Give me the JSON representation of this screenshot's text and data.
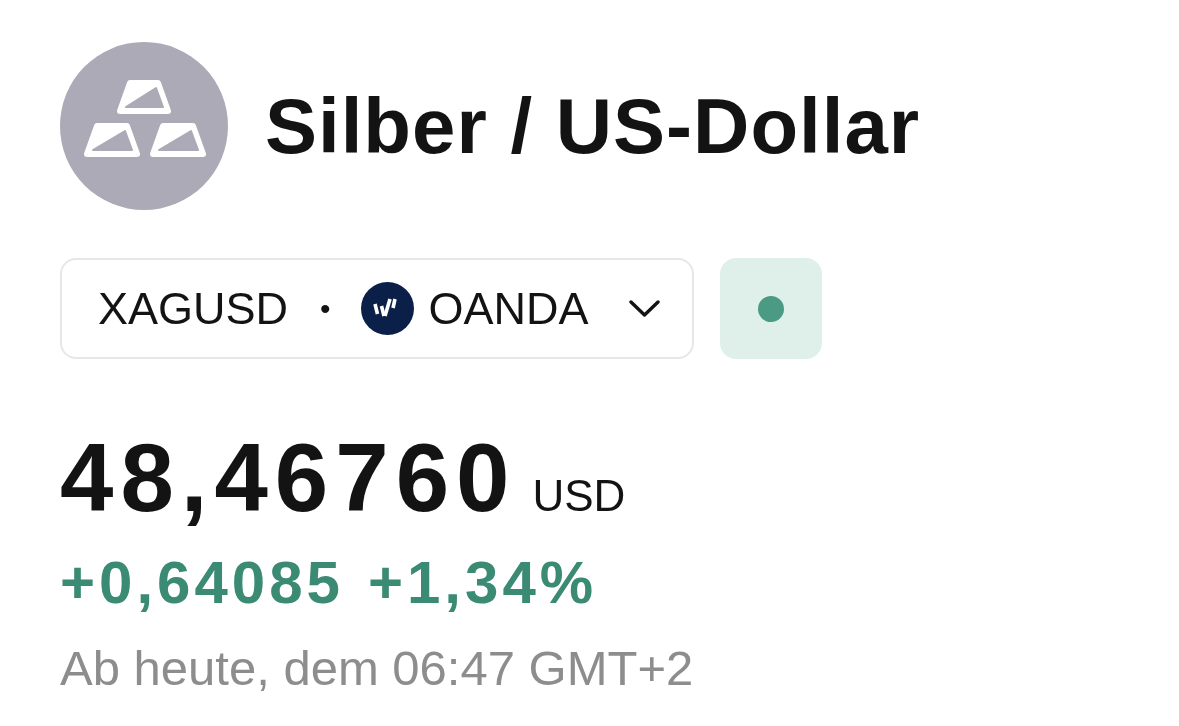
{
  "header": {
    "title": "Silber / US-Dollar"
  },
  "symbol_selector": {
    "symbol": "XAGUSD",
    "separator": "•",
    "exchange": "OANDA",
    "expanded": false
  },
  "market_status": {
    "open": true
  },
  "quote": {
    "price": "48,46760",
    "currency": "USD",
    "rising": true,
    "change": "+0,64085",
    "change_percent": "+1,34%",
    "timestamp": "Ab heute, dem 06:47 GMT+2"
  }
}
